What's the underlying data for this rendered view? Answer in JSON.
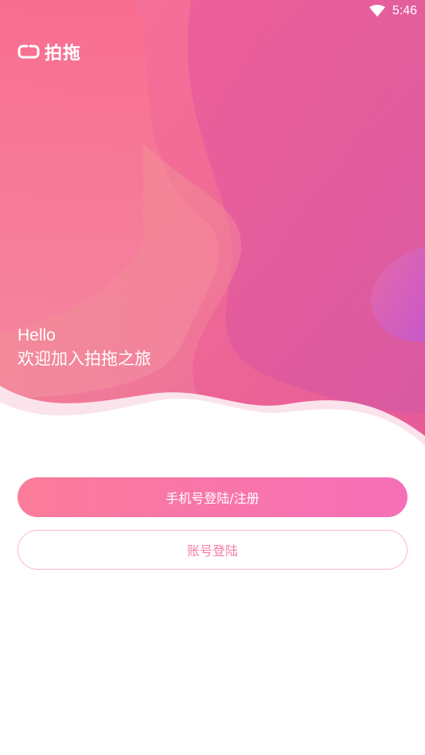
{
  "status_bar": {
    "time": "5:46",
    "wifi_icon": "wifi-icon"
  },
  "app": {
    "logo_icon": "logo-mark-icon",
    "name": "拍拖"
  },
  "greeting": {
    "line1": "Hello",
    "line2": "欢迎加入拍拖之旅"
  },
  "actions": {
    "phone_login_label": "手机号登陆/注册",
    "account_login_label": "账号登陆"
  },
  "colors": {
    "primary_gradient_start": "#fb7c9a",
    "primary_gradient_end": "#f56fb8",
    "secondary_border": "#f9b7c9",
    "secondary_text": "#f57fa6"
  }
}
